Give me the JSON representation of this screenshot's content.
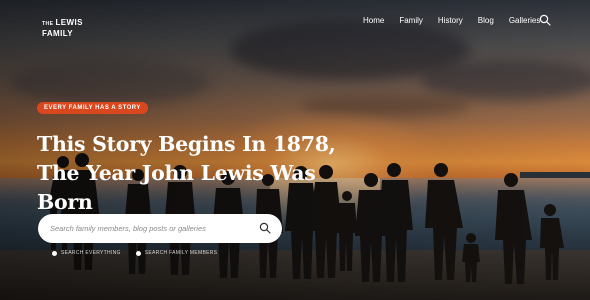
{
  "logo": {
    "small": "THE",
    "line1": "LEWIS",
    "line2": "FAMILY"
  },
  "nav": {
    "items": [
      {
        "label": "Home"
      },
      {
        "label": "Family"
      },
      {
        "label": "History"
      },
      {
        "label": "Blog"
      },
      {
        "label": "Galleries"
      }
    ],
    "search_icon": "search-icon"
  },
  "hero": {
    "tag": "EVERY FAMILY HAS A STORY",
    "headline_line1": "This Story Begins In 1878,",
    "headline_line2": "The Year John Lewis Was Born",
    "search": {
      "placeholder": "Search family members, blog posts or galleries",
      "icon": "search-icon"
    },
    "options": [
      {
        "label": "SEARCH EVERYTHING",
        "selected": true
      },
      {
        "label": "SEARCH FAMILY MEMBERS",
        "selected": false
      }
    ]
  },
  "colors": {
    "accent": "#d9471f",
    "text": "#ffffff"
  }
}
